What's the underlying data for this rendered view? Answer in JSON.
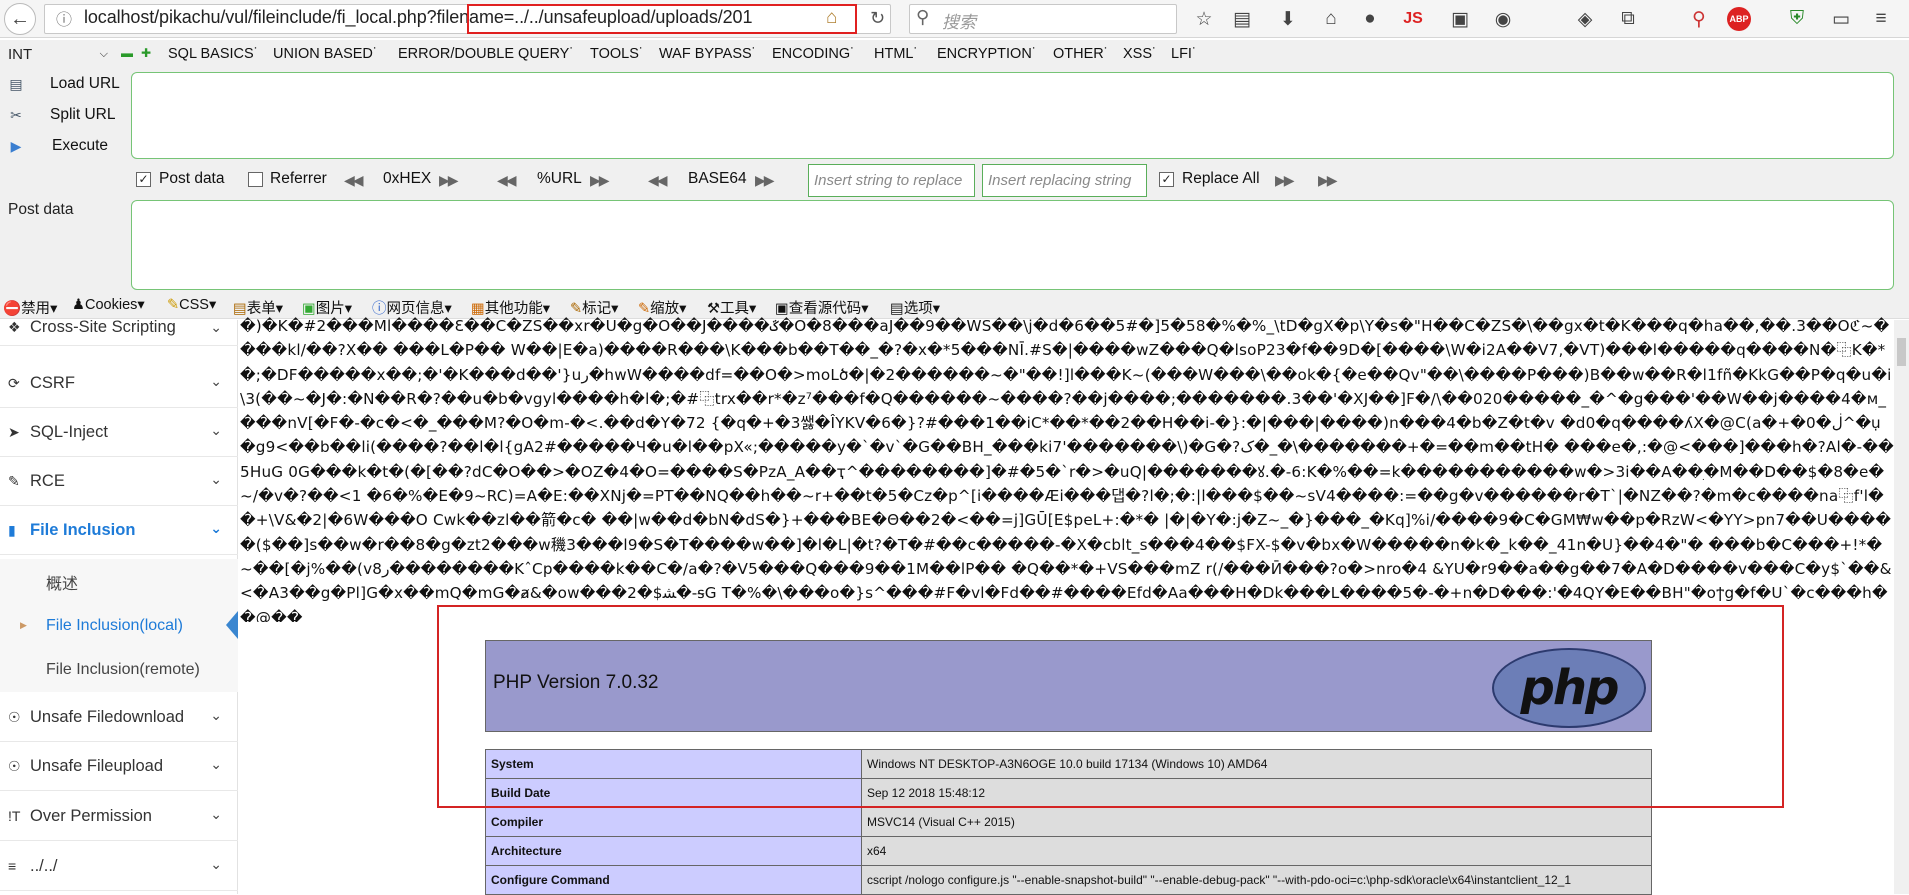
{
  "browser": {
    "url": "localhost/pikachu/vul/fileinclude/fi_local.php?filename=../../unsafeupload/uploads/201",
    "search_placeholder": "搜索",
    "toolbar_icons": [
      "star-icon",
      "reading-list-icon",
      "download-icon",
      "home-icon",
      "avatar-icon",
      "js-icon",
      "image-icon",
      "palette-icon",
      "hat-icon",
      "share-icon",
      "zoom-icon",
      "abp-icon",
      "shield-icon",
      "screen-icon"
    ],
    "js_label": "JS",
    "abp_label": "ABP"
  },
  "hackbar": {
    "select_value": "INT",
    "menus": [
      "SQL BASICS",
      "UNION BASED",
      "ERROR/DOUBLE QUERY",
      "TOOLS",
      "WAF BYPASS",
      "ENCODING",
      "HTML",
      "ENCRYPTION",
      "OTHER",
      "XSS",
      "LFI"
    ],
    "load_url": "Load URL",
    "split_url": "Split URL",
    "execute": "Execute",
    "post_data_check": "Post data",
    "referrer_check": "Referrer",
    "hex": "0xHEX",
    "url_enc": "%URL",
    "base64": "BASE64",
    "replace_ph": "Insert string to replace",
    "replacing_ph": "Insert replacing string",
    "replace_all": "Replace All",
    "post_data_label": "Post data",
    "url_value": "",
    "post_value": ""
  },
  "plugins": [
    "禁用",
    "Cookies",
    "CSS",
    "表单",
    "图片",
    "网页信息",
    "其他功能",
    "标记",
    "缩放",
    "工具",
    "查看源代码",
    "选项"
  ],
  "sidebar": {
    "items": [
      {
        "label": "Cross-Site Scripting",
        "icon": "xss-icon"
      },
      {
        "label": "CSRF",
        "icon": "refresh-icon"
      },
      {
        "label": "SQL-Inject",
        "icon": "inject-icon"
      },
      {
        "label": "RCE",
        "icon": "edit-icon"
      },
      {
        "label": "File Inclusion",
        "icon": "file-icon"
      },
      {
        "label": "Unsafe Filedownload",
        "icon": "download-circle-icon"
      },
      {
        "label": "Unsafe Fileupload",
        "icon": "upload-circle-icon"
      },
      {
        "label": "Over Permission",
        "icon": "permission-icon"
      },
      {
        "label": "../../",
        "icon": "list-icon"
      }
    ],
    "sub_items": [
      "概述",
      "File Inclusion(local)",
      "File Inclusion(remote)"
    ]
  },
  "content": {
    "garbage_text": "�)�K�#2���Ml����Ɛ��C�ZS��xr�U�g�O��J����ػ�O�8���aJ��9��WS��\\j�d�6��5#�]5�58�%�%_\\tD�gX�p\\Y�s�\"H��C�ZS�\\��gx�t�K���q�ha��,��.3��Oℭ~����kl/��?X��  ���L�P�� W��|E�a)����R���\\K���b��T��_�?�x�*5���NĪ.#S�|����wZ���Q�lsoP23�f��9D�[����\\W�i2A��V7,�VT)���l�����q����N�⿻K�*�;�DF�����x��;�'�K���d��'}uﺭ�hwW����df=��O�>moLծ�|�2������~�\"��!]l���K~(���W���\\��ok�{�e��Qv\"��\\����P���)B��w��R�l1fñ�KkG��P�q�u�i\\3(��~�J�:�N��R�?��u�b�vgyl����h�l�;�#⿻trx��r*�z⁷���f�Q������~����?��j����;�������.3��'�XJ��]F�/\\��020�����_�^�g���'��W��j����4�м_ ���nV[�F�-�c�<�_���M?�O�m-�<.��d�Y�72 {�q�+�3쌣�ÎYKV�6�}?#���1��iC*��*��2��H��i-�}:�|���|����)n���4�b�Z�t�v �d0�q����ʎX�@C(a�+�0�ڶ^�ụ�g9<��b��li(����?��l�l{gA2#�����Ч�u�l��pX«;�����y�`�v`�G��BH_���ki7'�������\\)�G�?ک�_�\\�������+�=��m��tH� ���e�,:�@<���]���h�?Al�-��5HuG 0G���k�t�(�[��?dC�O��>�OZ�4�O=����S�PzA_A��ҭ^��������]�#�5�`r�>�uQ|�������ꙋ.�-6:K�%��=k�����������w�>3i��A��ׅ�M��D��$�8�e�~/�v�?��<1 �6�%�E�9~RC)=A�E:��XNj�=PT��NQ��h��~r+��t�5�Cz�p^[i����Æi���댑�?l�;�:|l���$��~sV4����:=��g�v������r�T`|�NZ��?�m�c����na⿻f'l��+\\V&�2|�6W���O Cwk��zl��箭�c�  ��|w��d�bN�dS�}+���BE�Θ��2�<��=j]GŪ[E$peL+:�*� |�|�Y�:j�Z~_�}���_�Kq]%i/����9�C�GM₩w��p�RzW<�YY>pn7��U�����($��]s��w�r��8�g�zt2���w穖3���l9�S�T����w��]�l�L|�t?�T�#��c�����-�X�cblt_s���4��$FX-$�v�bx�W�����n�k�_k��_41n�U}��4�\"�  ���b�C���+!*�~��[�j%��(v8ر��������KˆCp����k��C�/a�?�V5���Q���9��1M��lP��  �Q��*�+VS���mZ r(/���Ӣ���?o�>nro�4 &YU�r9��a��g��7�A�D����v���C�y$`��&<�A3��g�Pl]G�x��mQ�mG�ⱥ&�ow���2�$ﺸ�-ꟊG T�%�\\���o�}s^���#F�vl�Fd��#����Efd�Aa���H�Dk���L����5�-�+n�D���:'�4QY�E��BH\"�oϯg�f�U`�c���h��@��",
    "php_title": "PHP Version 7.0.32",
    "php_logo_text": "php",
    "php_rows": [
      {
        "key": "System",
        "value": "Windows NT DESKTOP-A3N6OGE 10.0 build 17134 (Windows 10) AMD64"
      },
      {
        "key": "Build Date",
        "value": "Sep 12 2018 15:48:12"
      },
      {
        "key": "Compiler",
        "value": "MSVC14 (Visual C++ 2015)"
      },
      {
        "key": "Architecture",
        "value": "x64"
      },
      {
        "key": "Configure Command",
        "value": "cscript /nologo configure.js \"--enable-snapshot-build\" \"--enable-debug-pack\" \"--with-pdo-oci=c:\\php-sdk\\oracle\\x64\\instantclient_12_1"
      }
    ]
  },
  "colors": {
    "highlight": "#e02020",
    "hackbar_green": "#76c476",
    "php_header": "#9999cc",
    "php_key": "#ccccff",
    "php_value": "#dddddd",
    "active_blue": "#1e7bd8"
  }
}
